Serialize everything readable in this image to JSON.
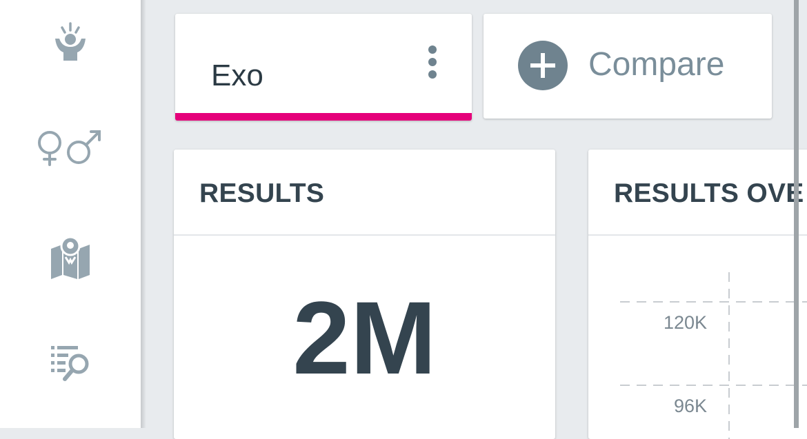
{
  "sidebar": {
    "items": [
      {
        "icon": "audience-icon"
      },
      {
        "icon": "gender-icon"
      },
      {
        "icon": "map-icon"
      },
      {
        "icon": "search-list-icon"
      }
    ]
  },
  "filter": {
    "label": "Exo",
    "accent_color": "#e5007a",
    "menu_icon": "kebab-menu-icon"
  },
  "compare": {
    "label": "Compare",
    "icon": "plus-circle-icon"
  },
  "results": {
    "title": "RESULTS",
    "value": "2M"
  },
  "results_over": {
    "title": "RESULTS OVE",
    "ticks": [
      "120K",
      "96K"
    ]
  }
}
